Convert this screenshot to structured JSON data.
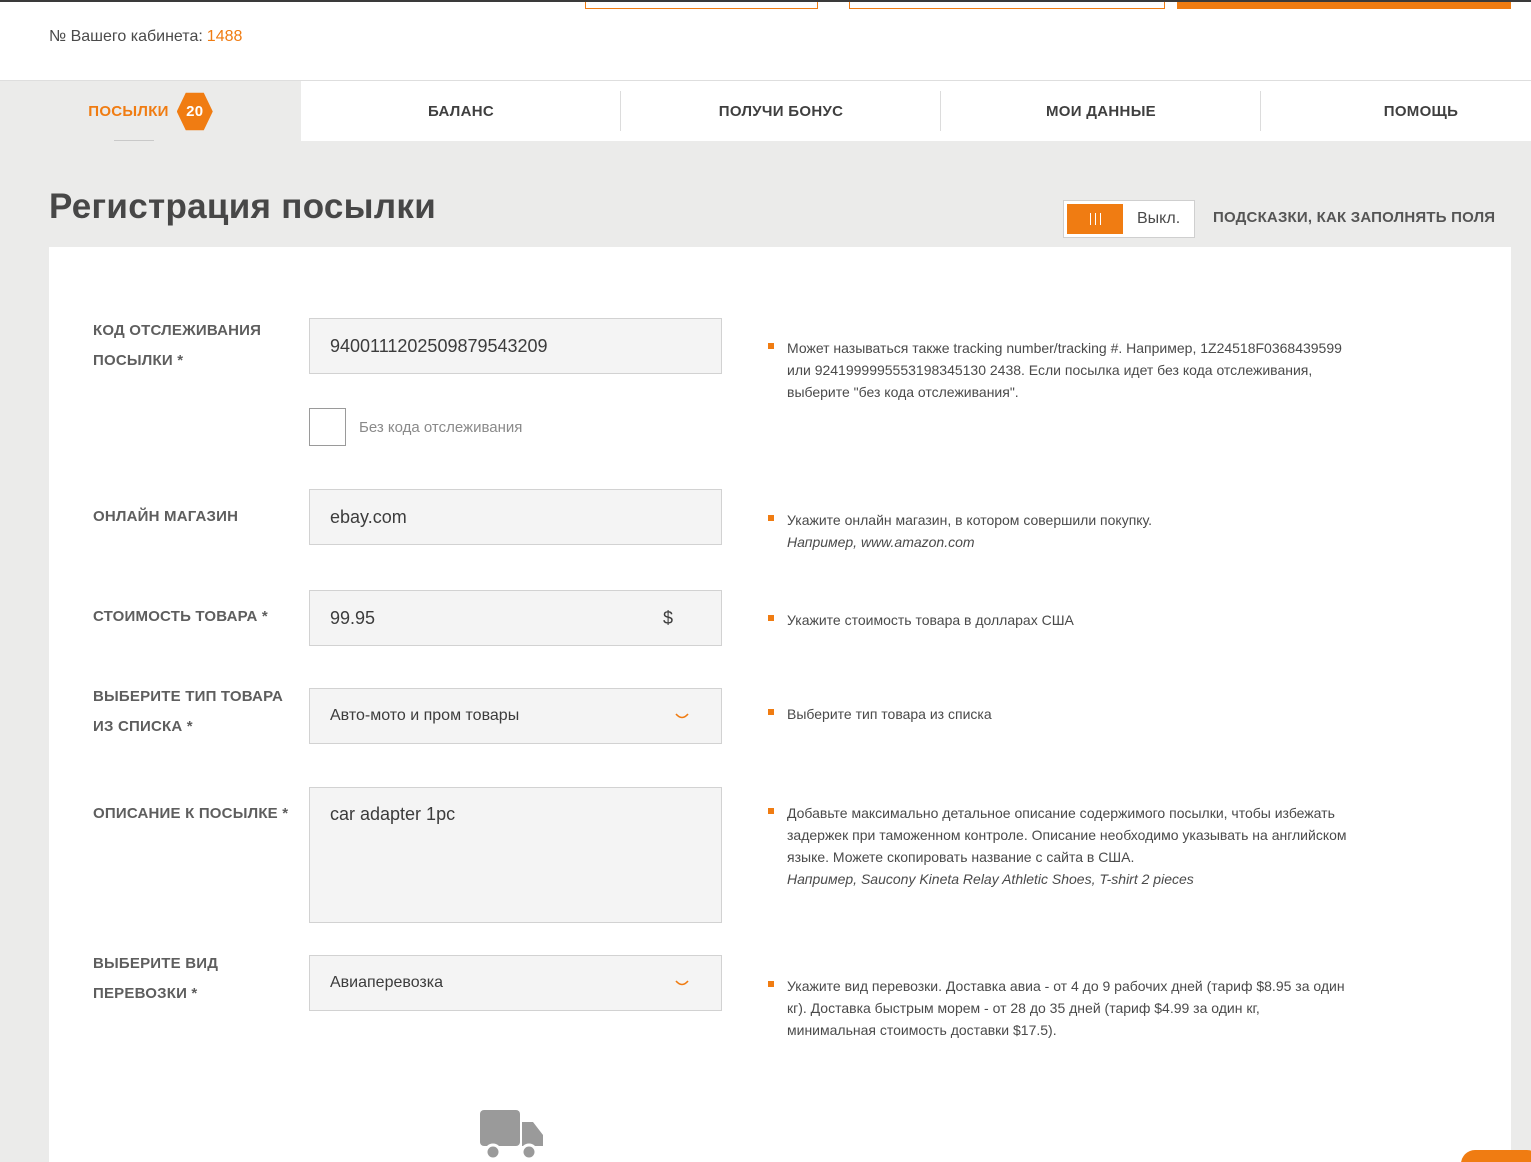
{
  "header": {
    "cabinet_label": "№ Вашего кабинета:",
    "cabinet_number": "1488"
  },
  "tabs": [
    {
      "label": "ПОСЫЛКИ",
      "badge": "20",
      "active": true
    },
    {
      "label": "БАЛАНС"
    },
    {
      "label": "ПОЛУЧИ БОНУС"
    },
    {
      "label": "МОИ ДАННЫЕ"
    },
    {
      "label": "ПОМОЩЬ"
    }
  ],
  "page": {
    "title": "Регистрация посылки",
    "toggle_state": "Выкл.",
    "hints_label": "ПОДСКАЗКИ, КАК ЗАПОЛНЯТЬ ПОЛЯ"
  },
  "form": {
    "tracking": {
      "label": "КОД ОТСЛЕЖИВАНИЯ ПОСЫЛКИ *",
      "value": "9400111202509879543209",
      "no_tracking_label": "Без кода отслеживания",
      "hint": "Может называться также tracking number/tracking #. Например, 1Z24518F0368439599 или 9241999995553198345130 2438. Если посылка идет без кода отслеживания, выберите \"без кода отслеживания\"."
    },
    "shop": {
      "label": "ОНЛАЙН МАГАЗИН",
      "value": "ebay.com",
      "hint": "Укажите онлайн магазин, в котором совершили покупку.",
      "hint_example": "Например, www.amazon.com"
    },
    "price": {
      "label": "СТОИМОСТЬ ТОВАРА *",
      "value": "99.95",
      "currency": "$",
      "hint": "Укажите стоимость товара в долларах США"
    },
    "category": {
      "label": "ВЫБЕРИТЕ ТИП ТОВАРА ИЗ СПИСКА *",
      "value": "Авто-мото и пром товары",
      "hint": "Выберите тип товара из списка"
    },
    "description": {
      "label": "ОПИСАНИЕ К ПОСЫЛКЕ *",
      "value": "car adapter 1pc",
      "hint": "Добавьте максимально детальное описание содержимого посылки, чтобы избежать задержек при таможенном контроле. Описание необходимо указывать на английском языке. Можете скопировать название с сайта в США.",
      "hint_example": "Например, Saucony Kineta Relay Athletic Shoes, T-shirt 2 pieces"
    },
    "shipping": {
      "label": "ВЫБЕРИТЕ ВИД ПЕРЕВОЗКИ *",
      "value": "Авиаперевозка",
      "hint": "Укажите вид перевозки. Доставка авиа - от 4 до 9 рабочих дней (тариф $8.95 за один кг). Доставка быстрым морем - от 28 до 35 дней (тариф $4.99 за один кг, минимальная стоимость доставки $17.5)."
    }
  },
  "colors": {
    "accent": "#f07c12",
    "background": "#ebebea",
    "panel": "#ffffff"
  },
  "icons": {
    "truck": "truck-icon",
    "chevron": "chevron-down-icon"
  }
}
